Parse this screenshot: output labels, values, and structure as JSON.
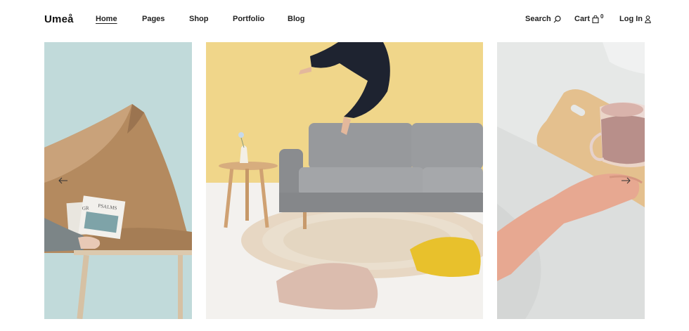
{
  "header": {
    "logo": "Umeå",
    "nav": [
      {
        "label": "Home",
        "active": true
      },
      {
        "label": "Pages",
        "active": false
      },
      {
        "label": "Shop",
        "active": false
      },
      {
        "label": "Portfolio",
        "active": false
      },
      {
        "label": "Blog",
        "active": false
      }
    ],
    "search_label": "Search",
    "cart_label": "Cart",
    "cart_count": "0",
    "login_label": "Log In"
  },
  "slider": {
    "prev_icon": "arrow-left-icon",
    "next_icon": "arrow-right-icon",
    "book_titles": [
      "GR",
      "PSALMS"
    ]
  },
  "colors": {
    "left_bg": "#bcd6d6",
    "mid_wall": "#f0d68a",
    "sofa": "#8d8f92",
    "pillow_yellow": "#e8c12c",
    "pillow_pink": "#d8b8a8",
    "right_bg": "#e6e8e7"
  }
}
